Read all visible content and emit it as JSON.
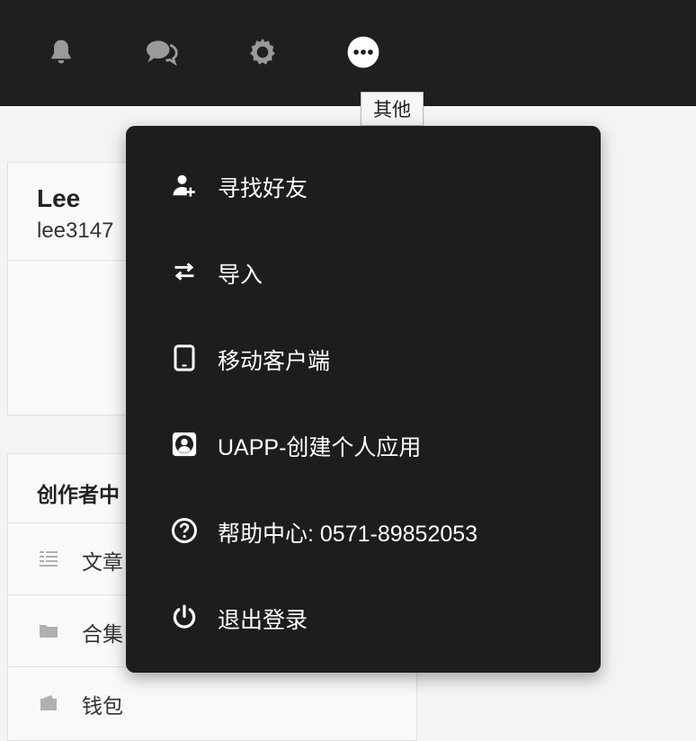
{
  "topbar": {
    "buttons": [
      {
        "icon": "bell-icon"
      },
      {
        "icon": "chat-icon"
      },
      {
        "icon": "gear-icon"
      },
      {
        "icon": "more-icon"
      }
    ],
    "tooltip": "其他"
  },
  "profile": {
    "name": "Lee",
    "handle": "lee3147"
  },
  "creator": {
    "title": "创作者中",
    "items": [
      {
        "label": "文章",
        "icon": "list-icon"
      },
      {
        "label": "合集",
        "icon": "folder-icon"
      },
      {
        "label": "钱包",
        "icon": "wallet-icon"
      }
    ]
  },
  "menu": {
    "items": [
      {
        "label": "寻找好友",
        "icon": "add-user-icon"
      },
      {
        "label": "导入",
        "icon": "swap-icon"
      },
      {
        "label": "移动客户端",
        "icon": "tablet-icon"
      },
      {
        "label": "UAPP-创建个人应用",
        "icon": "app-user-icon"
      },
      {
        "label": "帮助中心: 0571-89852053",
        "icon": "help-icon"
      },
      {
        "label": "退出登录",
        "icon": "power-icon"
      }
    ]
  },
  "colors": {
    "topbar_bg": "#1f1f1f",
    "menu_bg": "#1e1d1d",
    "page_bg": "#f4f4f4",
    "icon_gray": "#9a9a9a",
    "menu_text": "#ffffff"
  }
}
